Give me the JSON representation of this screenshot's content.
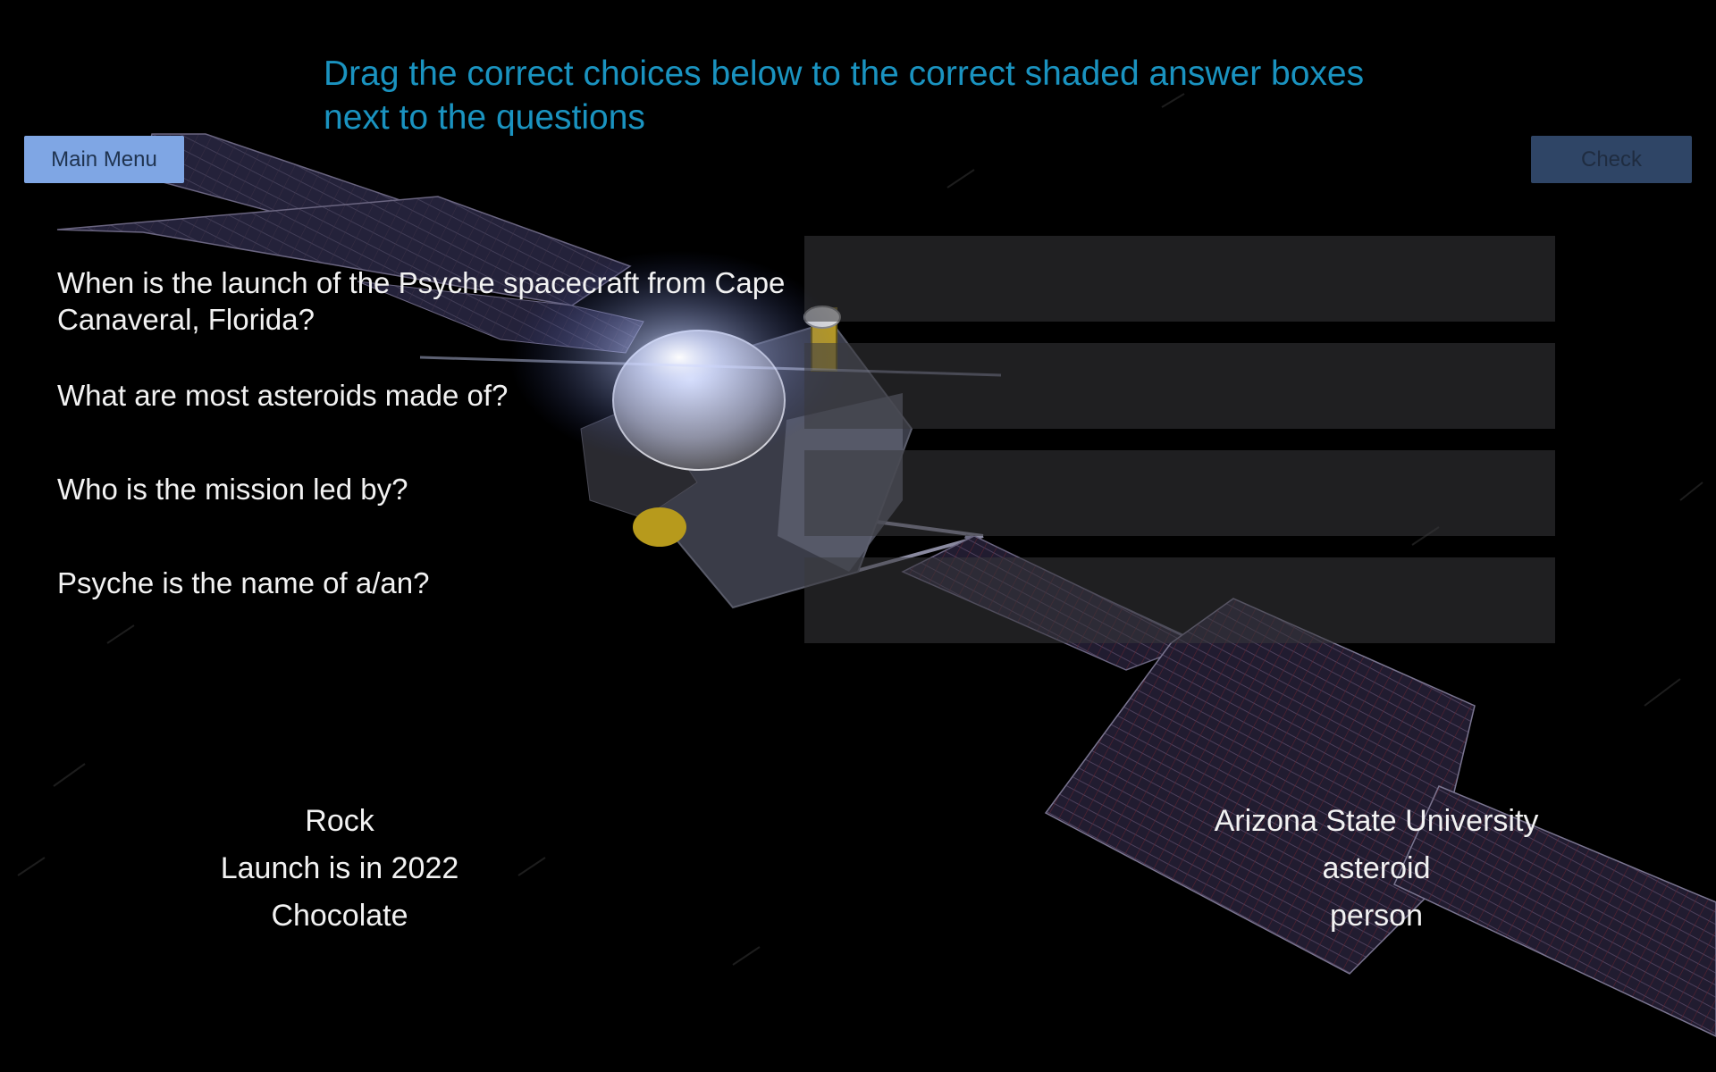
{
  "instructions": "Drag the correct choices below to the correct shaded answer boxes next to the questions",
  "buttons": {
    "main_menu": "Main Menu",
    "check": "Check"
  },
  "questions": [
    "When is the launch of the Psyche spacecraft from Cape Canaveral, Florida?",
    "What are most asteroids made of?",
    "Who is the mission led by?",
    "Psyche is the name of a/an?"
  ],
  "answer_boxes": [
    "",
    "",
    "",
    ""
  ],
  "choices_left": [
    "Rock",
    "Launch is in 2022",
    "Chocolate"
  ],
  "choices_right": [
    "Arizona State University",
    "asteroid",
    "person"
  ],
  "colors": {
    "instructions_text": "#1a93c0",
    "main_menu_button": "#7fa6e4",
    "check_button": "#2f4566",
    "background": "#000000"
  }
}
